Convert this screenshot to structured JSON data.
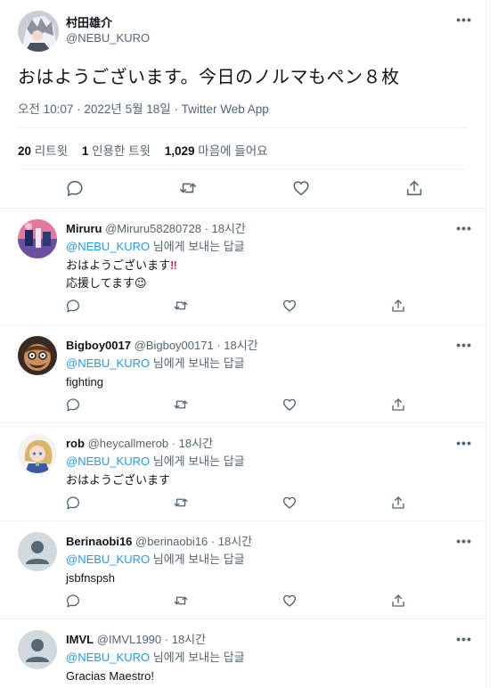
{
  "tweet": {
    "author_name": "村田雄介",
    "author_handle": "@NEBU_KURO",
    "text": "おはようございます。今日のノルマもペン８枚",
    "meta": "오전 10:07 · 2022년 5월 18일 · Twitter Web App",
    "stats": {
      "retweets_count": "20",
      "retweets_label": "리트윗",
      "quotes_count": "1",
      "quotes_label": "인용한 트윗",
      "likes_count": "1,029",
      "likes_label": "마음에 들어요"
    }
  },
  "reply_to_prefix": "@NEBU_KURO",
  "reply_to_suffix": "님에게 보내는 답글",
  "replies": [
    {
      "name": "Miruru",
      "handle": "@Miruru58280728",
      "time": "18시간",
      "line1": "おはようございます",
      "emoji1": "‼",
      "line2": "応援してます",
      "emoji2": "😉"
    },
    {
      "name": "Bigboy0017",
      "handle": "@Bigboy00171",
      "time": "18시간",
      "line1": "fighting"
    },
    {
      "name": "rob",
      "handle": "@heycallmerob",
      "time": "18시간",
      "line1": "おはようございます"
    },
    {
      "name": "Berinaobi16",
      "handle": "@berinaobi16",
      "time": "18시간",
      "line1": "jsbfnspsh"
    },
    {
      "name": "IMVL",
      "handle": "@IMVL1990",
      "time": "18시간",
      "line1": "Gracias Maestro!"
    }
  ],
  "colors": {
    "link": "#1d9bf0",
    "muted": "#536471",
    "text": "#0f1419",
    "divider": "#eff3f4",
    "alert": "#e0245e"
  }
}
